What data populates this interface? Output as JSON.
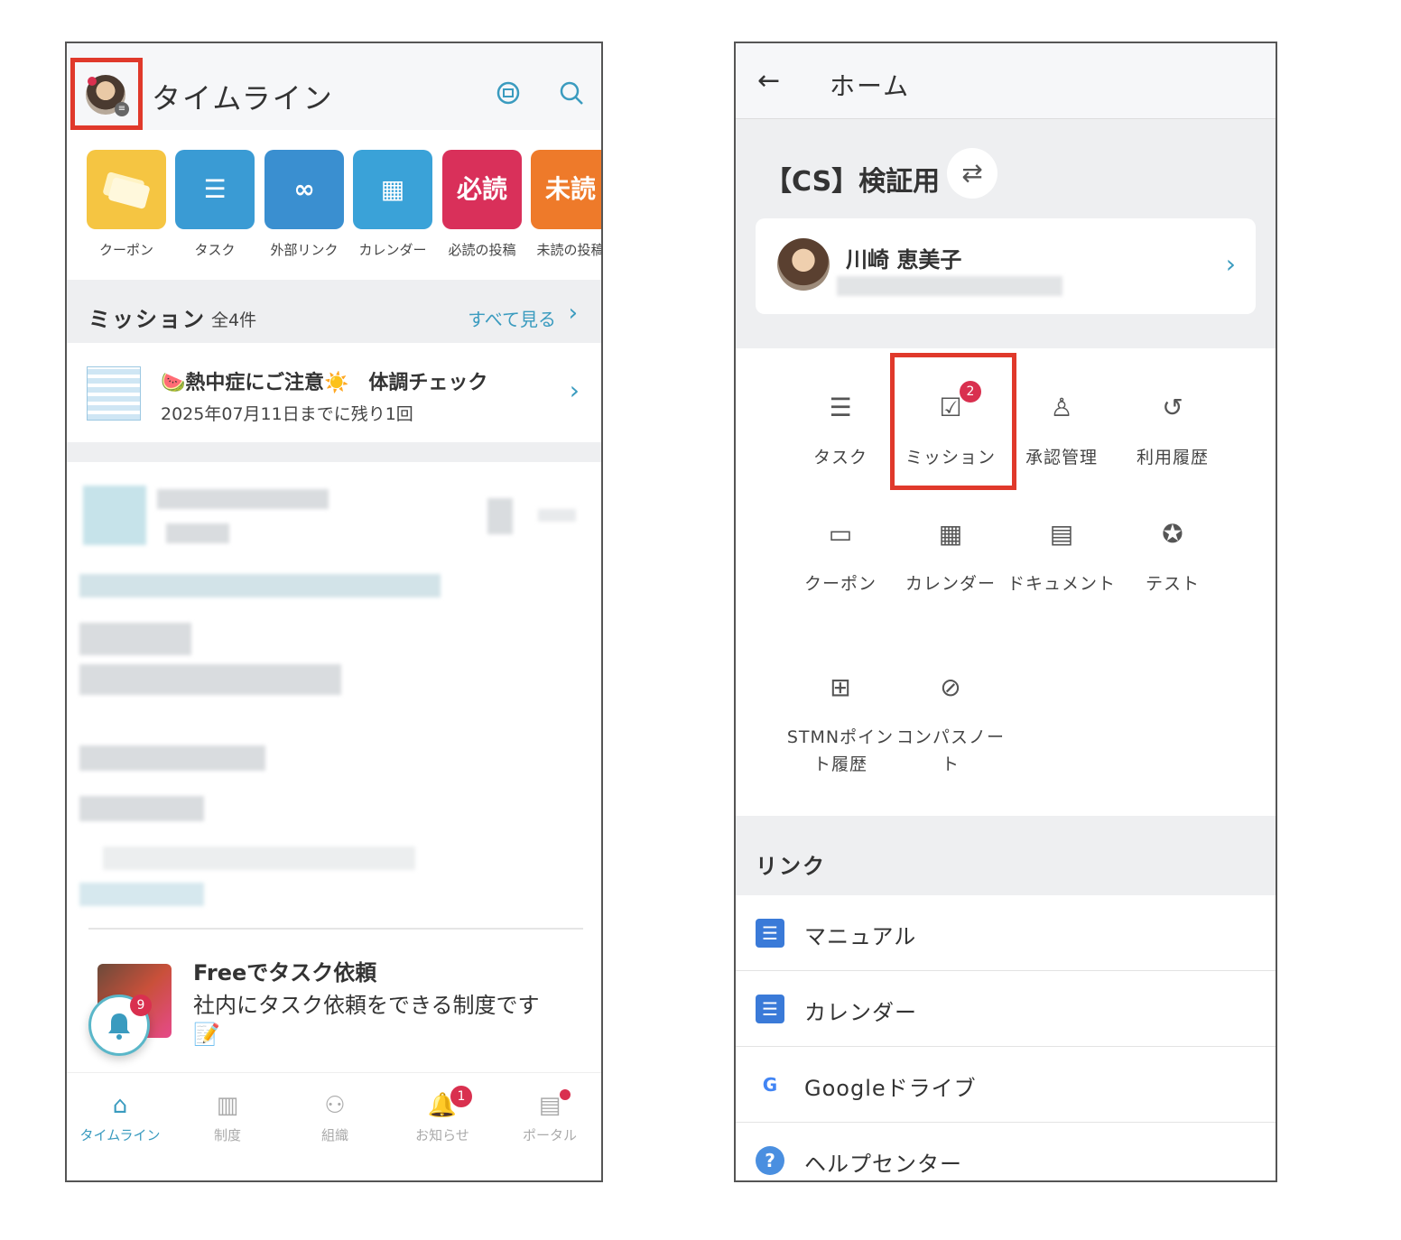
{
  "left": {
    "header": {
      "title": "タイムライン",
      "chat_icon": "chat-icon",
      "search_icon": "search-icon"
    },
    "shortcuts": [
      {
        "label": "クーポン",
        "tile_text": "",
        "color": "#f5c542",
        "icon": "ticket-icon"
      },
      {
        "label": "タスク",
        "tile_text": "",
        "color": "#3a9bd4",
        "icon": "checklist-icon"
      },
      {
        "label": "外部リンク",
        "tile_text": "",
        "color": "#3a8fd0",
        "icon": "link-icon"
      },
      {
        "label": "カレンダー",
        "tile_text": "",
        "color": "#3aa2d8",
        "icon": "calendar-icon"
      },
      {
        "label": "必読の投稿",
        "tile_text": "必読",
        "color": "#d9305a",
        "icon": ""
      },
      {
        "label": "未読の投稿",
        "tile_text": "未読",
        "color": "#ee7a2a",
        "icon": ""
      }
    ],
    "mission": {
      "title": "ミッション",
      "count": "全4件",
      "see_all": "すべて見る",
      "item_title": "🍉熱中症にご注意☀️　体調チェック",
      "item_sub": "2025年07月11日までに残り1回"
    },
    "free": {
      "title": "Freeでタスク依頼",
      "desc": "社内にタスク依頼をできる制度です",
      "emoji": "📝"
    },
    "bell_badge": "9",
    "bottom_nav": [
      {
        "label": "タイムライン",
        "icon": "home-icon",
        "glyph": "⌂",
        "badge": ""
      },
      {
        "label": "制度",
        "icon": "book-icon",
        "glyph": "▥",
        "badge": ""
      },
      {
        "label": "組織",
        "icon": "people-icon",
        "glyph": "⚇",
        "badge": ""
      },
      {
        "label": "お知らせ",
        "icon": "bell-icon",
        "glyph": "🔔",
        "badge": "1"
      },
      {
        "label": "ポータル",
        "icon": "portal-icon",
        "glyph": "▤",
        "badge": ""
      }
    ]
  },
  "right": {
    "header": {
      "title": "ホーム"
    },
    "org_name": "【CS】検証用",
    "profile_name": "川崎 恵美子",
    "menu": [
      {
        "label": "タスク",
        "icon": "checklist-icon",
        "glyph": "☰"
      },
      {
        "label": "ミッション",
        "icon": "checkbox-icon",
        "glyph": "☑",
        "badge": "2"
      },
      {
        "label": "承認管理",
        "icon": "stamp-icon",
        "glyph": "♙"
      },
      {
        "label": "利用履歴",
        "icon": "history-icon",
        "glyph": "↺"
      },
      {
        "label": "クーポン",
        "icon": "coupon-icon",
        "glyph": "▭"
      },
      {
        "label": "カレンダー",
        "icon": "calendar-icon",
        "glyph": "▦"
      },
      {
        "label": "ドキュメント",
        "icon": "document-icon",
        "glyph": "▤"
      },
      {
        "label": "テスト",
        "icon": "award-icon",
        "glyph": "✪"
      },
      {
        "label": "STMNポイント履歴",
        "icon": "gift-icon",
        "glyph": "⊞"
      },
      {
        "label": "コンパスノート",
        "icon": "compass-icon",
        "glyph": "⊘"
      }
    ],
    "links_title": "リンク",
    "links": [
      {
        "label": "マニュアル",
        "icon": "form-icon",
        "glyph": "☰",
        "color": "#3a7ad8"
      },
      {
        "label": "カレンダー",
        "icon": "form-icon",
        "glyph": "☰",
        "color": "#3a7ad8"
      },
      {
        "label": "Googleドライブ",
        "icon": "google-icon",
        "glyph": "G",
        "color": "#ffffff"
      },
      {
        "label": "ヘルプセンター",
        "icon": "help-icon",
        "glyph": "?",
        "color": "#4a8fe0"
      }
    ]
  }
}
